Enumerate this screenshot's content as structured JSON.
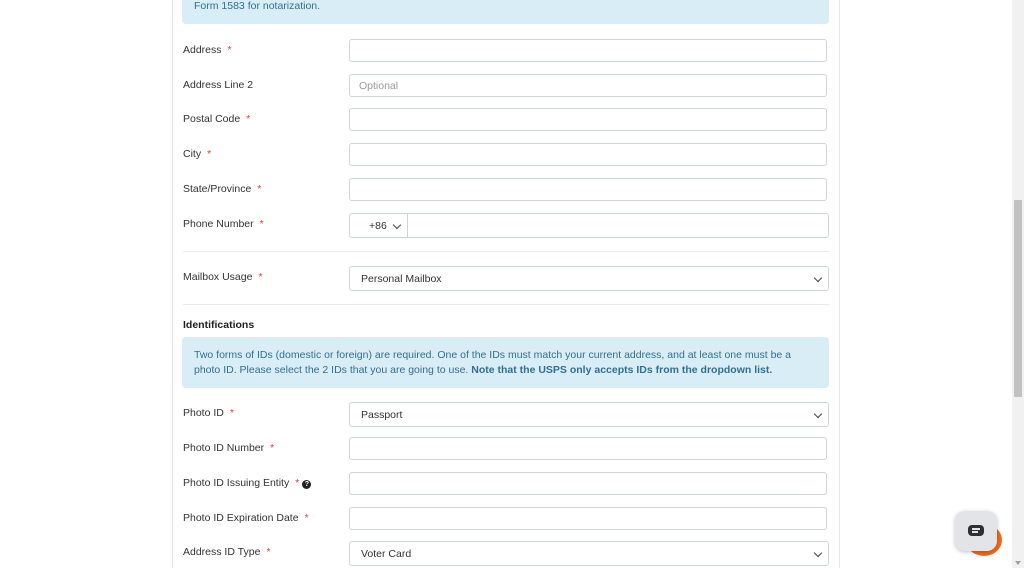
{
  "top_notice": {
    "text": "Form 1583 for notarization."
  },
  "fields": {
    "address": {
      "label": "Address",
      "required": "*",
      "value": ""
    },
    "address_line_2": {
      "label": "Address Line 2",
      "placeholder": "Optional",
      "value": ""
    },
    "postal_code": {
      "label": "Postal Code",
      "required": "*",
      "value": ""
    },
    "city": {
      "label": "City",
      "required": "*",
      "value": ""
    },
    "state_province": {
      "label": "State/Province",
      "required": "*",
      "value": ""
    },
    "phone_number": {
      "label": "Phone Number",
      "required": "*",
      "country_code": "+86",
      "value": ""
    },
    "mailbox_usage": {
      "label": "Mailbox Usage",
      "required": "*",
      "selected": "Personal Mailbox"
    }
  },
  "identifications": {
    "title": "Identifications",
    "notice_text": "Two forms of IDs (domestic or foreign) are required. One of the IDs must match your current address, and at least one must be a photo ID. Please select the 2 IDs that you are going to use. ",
    "notice_bold": "Note that the USPS only accepts IDs from the dropdown list.",
    "photo_id": {
      "label": "Photo ID",
      "required": "*",
      "selected": "Passport"
    },
    "photo_id_number": {
      "label": "Photo ID Number",
      "required": "*",
      "value": ""
    },
    "photo_id_issuing_entity": {
      "label": "Photo ID Issuing Entity",
      "required": "*",
      "help_icon": "question-circle-icon",
      "help_glyph": "?",
      "value": ""
    },
    "photo_id_expiration_date": {
      "label": "Photo ID Expiration Date",
      "required": "*",
      "value": ""
    },
    "address_id_type": {
      "label": "Address ID Type",
      "required": "*",
      "selected": "Voter Card"
    }
  },
  "chat": {
    "icon": "chat-bubble-icon",
    "accent": "#f06a1d"
  }
}
